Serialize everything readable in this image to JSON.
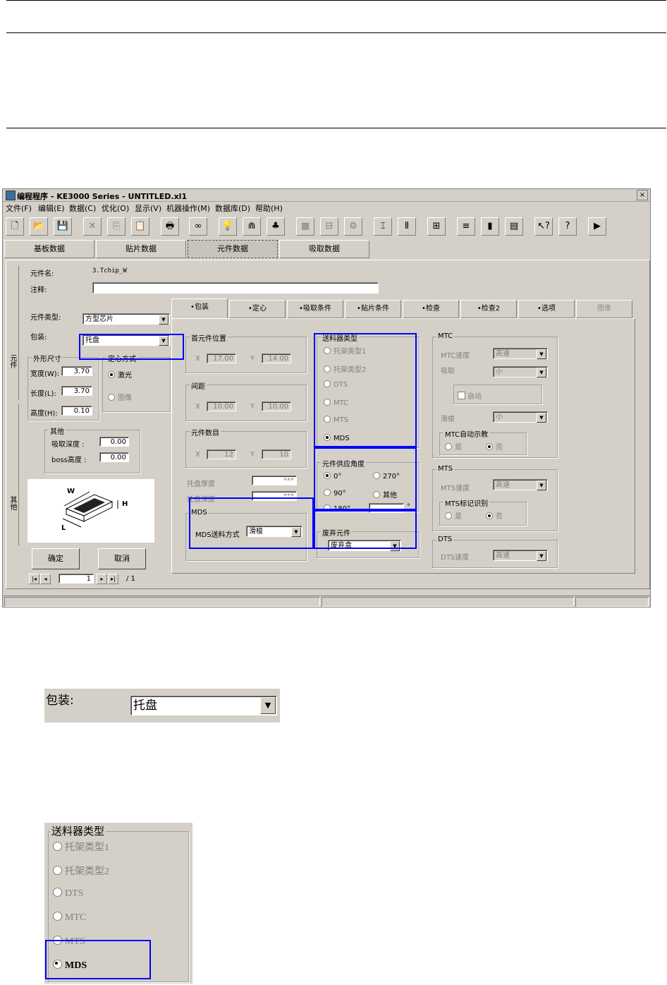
{
  "window": {
    "title": "编程程序 - KE3000 Series - UNTITLED.xl1",
    "close": "×",
    "menu": [
      "文件(F)",
      "编辑(E)",
      "数据(C)",
      "优化(O)",
      "显示(V)",
      "机器操作(M)",
      "数据库(D)",
      "帮助(H)"
    ]
  },
  "toolbar_icons": [
    "new-file-icon",
    "open-folder-icon",
    "save-icon",
    "delete-icon",
    "copy-icon",
    "paste-icon",
    "print-icon",
    "binoculars-icon",
    "lightbulb-icon",
    "magnet-icon",
    "molecule-icon",
    "grid-icon",
    "tray-icon",
    "settings-icon",
    "align-icon",
    "component-icon",
    "adjust-icon",
    "feeder-icon",
    "book-icon",
    "document-icon",
    "help-pointer-icon",
    "help-icon",
    "exit-icon"
  ],
  "main_tabs": [
    "基板数据",
    "贴片数据",
    "元件数据",
    "吸取数据"
  ],
  "side_tabs": [
    "元件",
    "其他"
  ],
  "part": {
    "name_label": "元件名:",
    "name_value": "3.Tchip_W",
    "comment_label": "注释:",
    "comment_value": "",
    "type_label": "元件类型:",
    "type_value": "方型芯片",
    "package_label": "包装:",
    "package_value": "托盘",
    "outline_title": "外形尺寸",
    "width_label": "宽度(W):",
    "width_value": "3.70",
    "length_label": "长度(L):",
    "length_value": "3.70",
    "height_label": "高度(H):",
    "height_value": "0.10",
    "centering_title": "定心方式",
    "centering_laser": "激光",
    "centering_image": "图像",
    "other_title": "其他",
    "pick_depth_label": "吸取深度 :",
    "pick_depth_value": "0.00",
    "boss_height_label": "boss高度 :",
    "boss_height_value": "0.00",
    "diagram_w": "W",
    "diagram_h": "H",
    "diagram_l": "L",
    "ok": "确定",
    "cancel": "取消",
    "page_value": "1",
    "page_total": "/ 1"
  },
  "sub_tabs": [
    "包装",
    "定心",
    "吸取条件",
    "贴片条件",
    "检查",
    "检查2",
    "选项",
    "图像"
  ],
  "packing": {
    "first_position_title": "首元件位置",
    "x_label": "X",
    "y_label": "Y",
    "first_x": "17.00",
    "first_y": "14.00",
    "pitch_title": "间距",
    "pitch_x": "10.00",
    "pitch_y": "10.00",
    "count_title": "元件数目",
    "count_x": "12",
    "count_y": "10",
    "tray_thickness_label": "托盘厚度",
    "tray_thickness_value": "***",
    "tray_depth_label": "托盘深度",
    "tray_depth_value": "***",
    "mds_title": "MDS",
    "mds_mode_label": "MDS送料方式",
    "mds_mode_value": "滑梭",
    "feeder_type_title": "送料器类型",
    "feeder_types": [
      "托架类型1",
      "托架类型2",
      "DTS",
      "MTC",
      "MTS",
      "MDS"
    ],
    "supply_angle_title": "元件供应角度",
    "angles": [
      "0°",
      "270°",
      "90°",
      "其他",
      "180°"
    ],
    "angle_other_unit": "°",
    "discard_title": "废弃元件",
    "discard_value": "废弃盒",
    "mtc_title": "MTC",
    "mtc_speed_label": "MTC速度",
    "mtc_speed_value": "高速",
    "pick_label": "吸取",
    "pick_value": "小",
    "auto_label": "自动",
    "shuttle_label": "滑梭",
    "shuttle_value": "小",
    "mtc_auto_teach_title": "MTC自动示教",
    "yes": "是",
    "no": "否",
    "mts_title": "MTS",
    "mts_speed_label": "MTS速度",
    "mts_speed_value": "高速",
    "mts_mark_title": "MTS标记识别",
    "dts_title": "DTS",
    "dts_speed_label": "DTS速度",
    "dts_speed_value": "高速"
  },
  "zoom_package": {
    "label": "包装:",
    "value": "托盘"
  },
  "zoom_feeder": {
    "title": "送料器类型",
    "options": [
      "托架类型1",
      "托架类型2",
      "DTS",
      "MTC",
      "MTS",
      "MDS"
    ]
  },
  "colors": {
    "highlight": "#0000ff",
    "window_bg": "#d4d0c8"
  }
}
